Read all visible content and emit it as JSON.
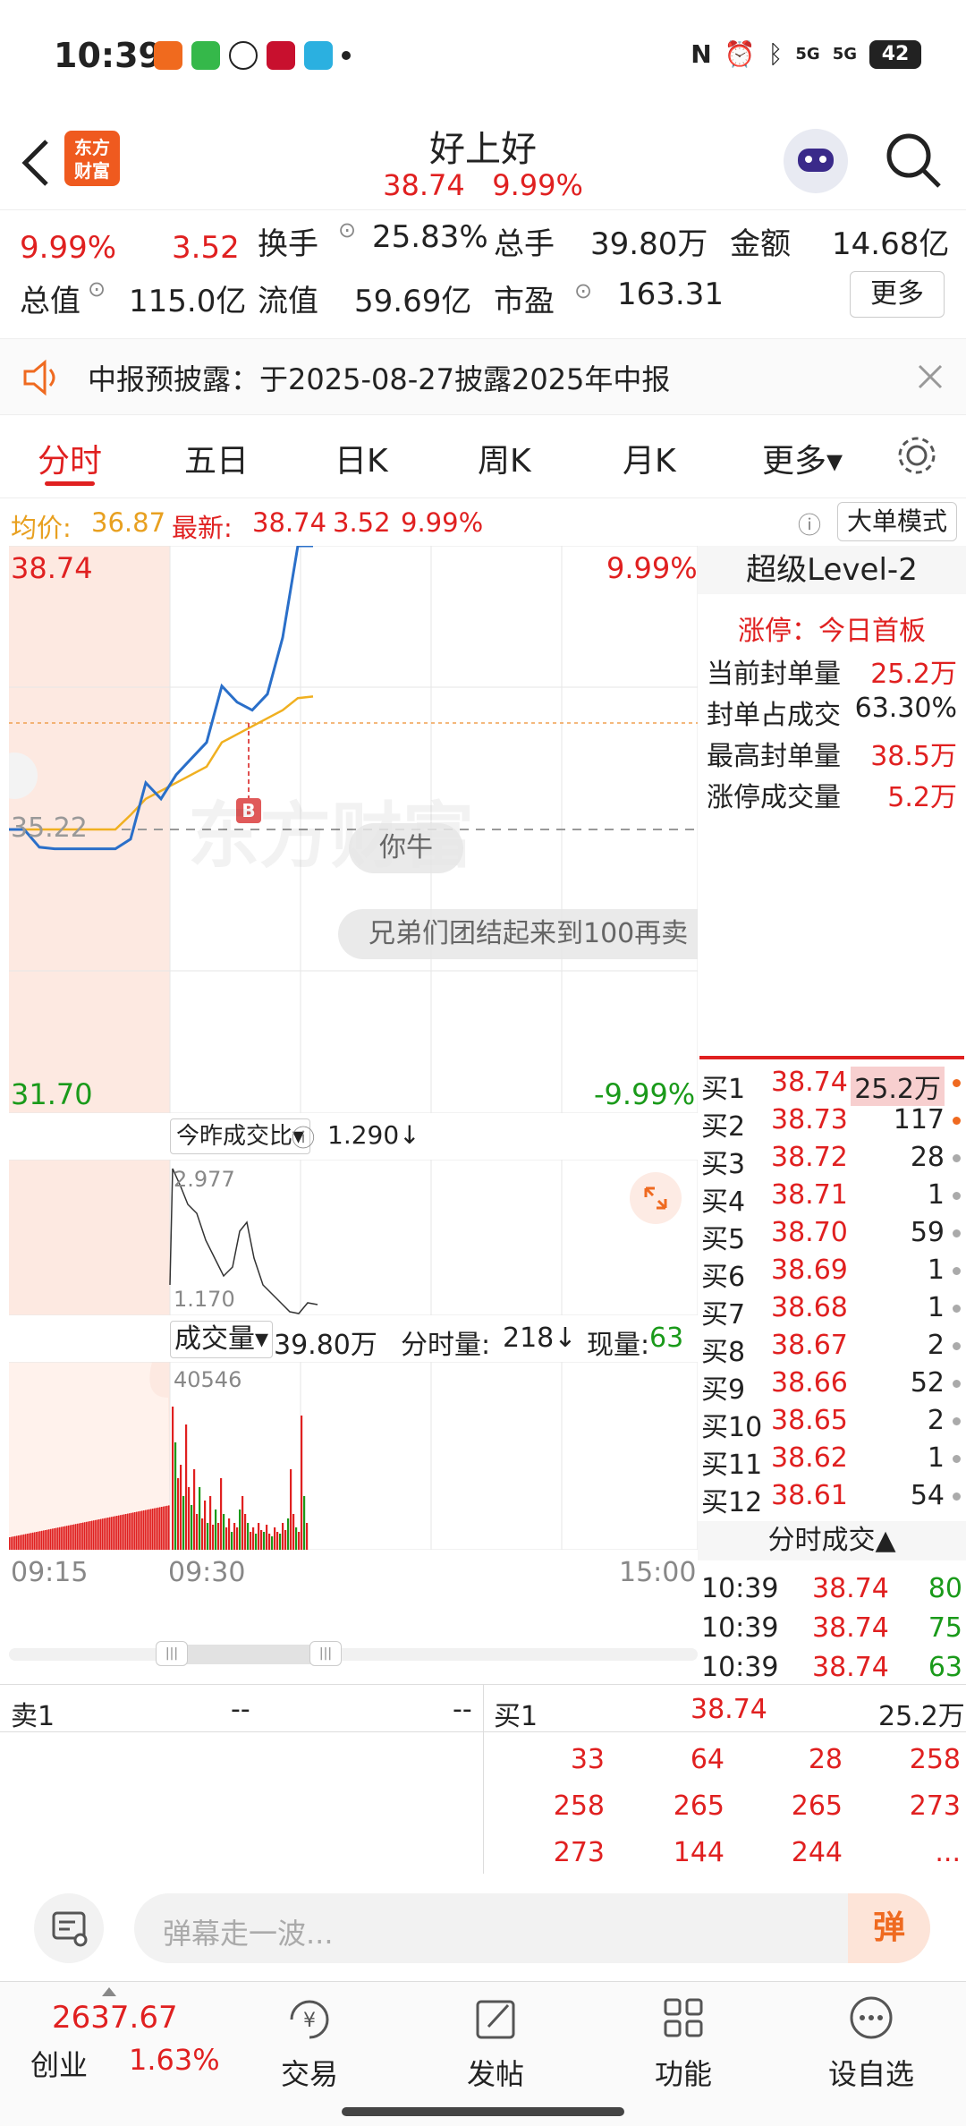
{
  "status": {
    "time": "10:39",
    "battery": "42",
    "net1": "5G",
    "net2": "5G"
  },
  "header": {
    "logo_text": "东方\n财富",
    "title": "好上好",
    "price": "38.74",
    "pct": "9.99%"
  },
  "quote": {
    "pct": "9.99%",
    "change": "3.52",
    "turnover_label": "换手",
    "turnover_value": "25.83%",
    "total_hands_label": "总手",
    "total_hands_value": "39.80万",
    "amount_label": "金额",
    "amount_value": "14.68亿",
    "mktcap_label": "总值",
    "mktcap_value": "115.0亿",
    "float_label": "流值",
    "float_value": "59.69亿",
    "pe_label": "市盈",
    "pe_value": "163.31",
    "more_label": "更多"
  },
  "notice": {
    "text": "中报预披露：于2025-08-27披露2025年中报"
  },
  "tabs": [
    {
      "label": "分时"
    },
    {
      "label": "五日"
    },
    {
      "label": "日K"
    },
    {
      "label": "周K"
    },
    {
      "label": "月K"
    },
    {
      "label": "更多▾"
    }
  ],
  "avgline": {
    "avg_label": "均价:",
    "avg_value": "36.87",
    "latest_label": "最新:",
    "latest_value": "38.74",
    "change": "3.52",
    "pct": "9.99%",
    "mode_label": "大单模式"
  },
  "chart": {
    "high_price": "38.74",
    "high_pct": "9.99%",
    "low_price": "31.70",
    "low_pct": "-9.99%",
    "mid_price": "35.22",
    "bubble1": "你牛",
    "bubble2": "兄弟们团结起来到100再卖",
    "watermark": "东方财富",
    "ratio_label": "今昨成交比▾",
    "ratio_value": "1.290↓",
    "ratio_high": "2.977",
    "ratio_low": "1.170",
    "volume_label": "成交量▾",
    "volume_value": "39.80万",
    "minute_vol_label": "分时量:",
    "minute_vol_value": "218↓",
    "current_vol_label": "现量:",
    "current_vol_value": "63",
    "vol_max": "40546",
    "time_start": "09:15",
    "time_mid": "09:30",
    "time_end": "15:00",
    "marker": "B"
  },
  "chart_data": {
    "type": "line",
    "title": "",
    "xlabel": "",
    "ylabel": "",
    "ylim": [
      31.7,
      38.74
    ],
    "x_ticks": [
      "09:15",
      "09:30",
      "15:00"
    ],
    "series": [
      {
        "name": "",
        "values": [
          35.22,
          35.22,
          35.0,
          34.98,
          34.98,
          34.98,
          34.98,
          34.98,
          35.1,
          35.8,
          35.6,
          35.9,
          36.1,
          36.3,
          37.0,
          36.8,
          36.7,
          36.9,
          37.6,
          38.74,
          38.74
        ]
      },
      {
        "name": "",
        "values": [
          35.22,
          35.22,
          35.22,
          35.22,
          35.22,
          35.22,
          35.22,
          35.22,
          35.4,
          35.6,
          35.7,
          35.8,
          35.9,
          36.0,
          36.3,
          36.4,
          36.5,
          36.6,
          36.7,
          36.85,
          36.87
        ]
      }
    ]
  },
  "level2": {
    "title": "超级Level-2",
    "limit_up": "涨停：今日首板",
    "rows": [
      {
        "label": "当前封单量",
        "value": "25.2万"
      },
      {
        "label": "封单占成交",
        "value": "63.30%"
      },
      {
        "label": "最高封单量",
        "value": "38.5万"
      },
      {
        "label": "涨停成交量",
        "value": "5.2万"
      }
    ]
  },
  "bids": [
    {
      "label": "买1",
      "price": "38.74",
      "qty": "25.2万",
      "dot": "#ef6a20"
    },
    {
      "label": "买2",
      "price": "38.73",
      "qty": "117",
      "dot": "#ef6a20"
    },
    {
      "label": "买3",
      "price": "38.72",
      "qty": "28",
      "dot": "#aaaaaa"
    },
    {
      "label": "买4",
      "price": "38.71",
      "qty": "1",
      "dot": "#aaaaaa"
    },
    {
      "label": "买5",
      "price": "38.70",
      "qty": "59",
      "dot": "#aaaaaa"
    },
    {
      "label": "买6",
      "price": "38.69",
      "qty": "1",
      "dot": "#aaaaaa"
    },
    {
      "label": "买7",
      "price": "38.68",
      "qty": "1",
      "dot": "#aaaaaa"
    },
    {
      "label": "买8",
      "price": "38.67",
      "qty": "2",
      "dot": "#aaaaaa"
    },
    {
      "label": "买9",
      "price": "38.66",
      "qty": "52",
      "dot": "#aaaaaa"
    },
    {
      "label": "买10",
      "price": "38.65",
      "qty": "2",
      "dot": "#aaaaaa"
    },
    {
      "label": "买11",
      "price": "38.62",
      "qty": "1",
      "dot": "#aaaaaa"
    },
    {
      "label": "买12",
      "price": "38.61",
      "qty": "54",
      "dot": "#aaaaaa"
    }
  ],
  "trades_title": "分时成交▲",
  "trades": [
    {
      "time": "10:39",
      "price": "38.74",
      "qty": "80"
    },
    {
      "time": "10:39",
      "price": "38.74",
      "qty": "75"
    },
    {
      "time": "10:39",
      "price": "38.74",
      "qty": "63"
    }
  ],
  "book": {
    "sell_label": "卖1",
    "sell_price": "--",
    "sell_qty": "--",
    "buy_label": "买1",
    "buy_price": "38.74",
    "buy_qty": "25.2万",
    "queue": [
      [
        "33",
        "64",
        "28",
        "258"
      ],
      [
        "258",
        "265",
        "265",
        "273"
      ],
      [
        "273",
        "144",
        "244",
        "..."
      ]
    ]
  },
  "danmu": {
    "placeholder": "弹幕走一波...",
    "send": "弹"
  },
  "nav": {
    "index_value": "2637.67",
    "index_name": "创业",
    "index_pct": "1.63%",
    "items": [
      {
        "label": "交易"
      },
      {
        "label": "发帖"
      },
      {
        "label": "功能"
      },
      {
        "label": "设自选"
      }
    ]
  },
  "colors": {
    "red": "#e02020",
    "green": "#1a9a1a",
    "orange": "#ef6a20",
    "blue": "#2a6fc9",
    "avg_yellow": "#f0b020"
  }
}
